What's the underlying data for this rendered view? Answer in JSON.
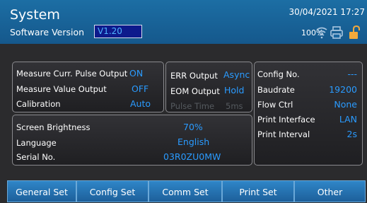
{
  "header": {
    "title": "System",
    "software_version_label": "Software Version",
    "software_version_value": "V1.20",
    "datetime": "30/04/2021 17:27",
    "battery": "100%",
    "icons": [
      "network-icon",
      "printer-icon",
      "unlock-icon"
    ]
  },
  "output_panel": {
    "pulse_label": "Measure Curr. Pulse Output",
    "pulse_value": "ON",
    "value_label": "Measure Value Output",
    "value_value": "OFF",
    "calibration_label": "Calibration",
    "calibration_value": "Auto"
  },
  "err_panel": {
    "err_label": "ERR Output",
    "err_value": "Async",
    "eom_label": "EOM Output",
    "eom_value": "Hold",
    "pulse_time_label": "Pulse Time",
    "pulse_time_value": "5ms"
  },
  "comm_panel": {
    "config_label": "Config No.",
    "config_value": "---",
    "baud_label": "Baudrate",
    "baud_value": "19200",
    "flow_label": "Flow Ctrl",
    "flow_value": "None",
    "print_if_label": "Print Interface",
    "print_if_value": "LAN",
    "print_int_label": "Print Interval",
    "print_int_value": "2s"
  },
  "general_panel": {
    "brightness_label": "Screen Brightness",
    "brightness_value": "70%",
    "language_label": "Language",
    "language_value": "English",
    "serial_label": "Serial No.",
    "serial_value": "03R0ZU0MW"
  },
  "tabs": [
    {
      "label": "General Set"
    },
    {
      "label": "Config Set"
    },
    {
      "label": "Comm Set"
    },
    {
      "label": "Print Set"
    },
    {
      "label": "Other"
    }
  ],
  "colors": {
    "header": "#1a67a0",
    "value": "#2a9bff",
    "background": "#2b2b2d",
    "tab": "#2677b5"
  }
}
